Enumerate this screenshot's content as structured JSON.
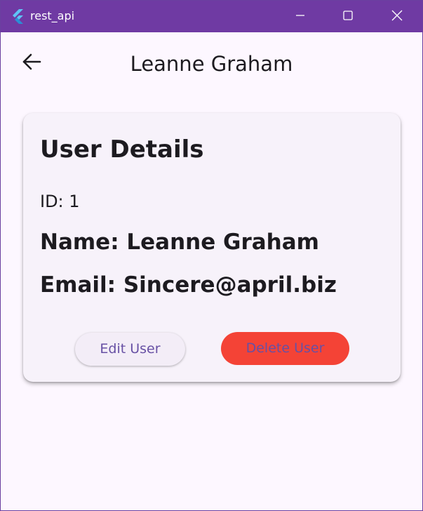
{
  "window": {
    "title": "rest_api",
    "icon": "flutter-logo-icon",
    "controls": [
      "minimize-icon",
      "maximize-icon",
      "close-icon"
    ]
  },
  "appbar": {
    "back_icon": "arrow-left-icon",
    "title": "Leanne Graham"
  },
  "card": {
    "heading": "User Details",
    "id_text": "ID: 1",
    "name_text": "Name: Leanne Graham",
    "email_text": "Email: Sincere@april.biz"
  },
  "buttons": {
    "edit_label": "Edit User",
    "delete_label": "Delete User"
  },
  "colors": {
    "titlebar": "#6f3aa3",
    "background": "#fdf7ff",
    "card": "#f7f2fa",
    "delete_button": "#f44336",
    "button_text": "#6750a4"
  }
}
